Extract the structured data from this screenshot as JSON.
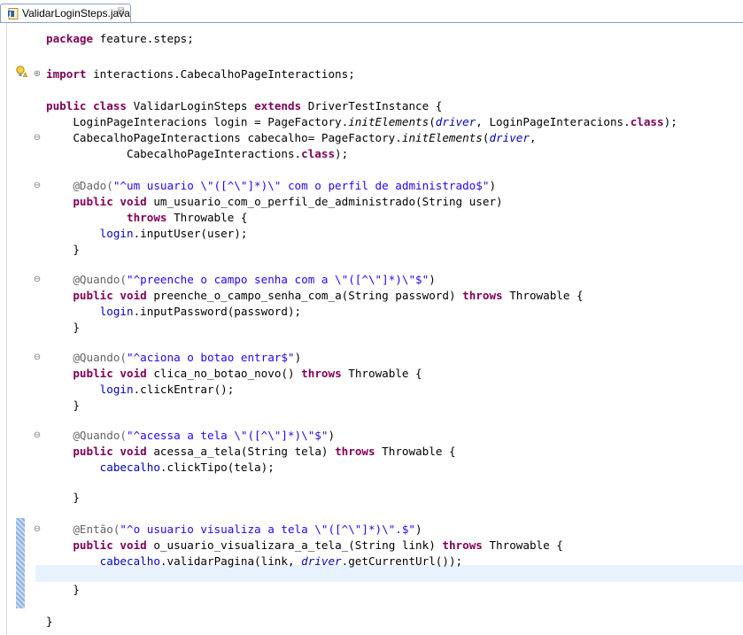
{
  "tab": {
    "title": "ValidarLoginSteps.java",
    "close_glyph": "☒",
    "icon": "java-file-icon"
  },
  "colors": {
    "keyword": "#7f0055",
    "string": "#2a00ff",
    "annotation": "#646464",
    "field": "#0000c0",
    "current_line": "#e8f2fe"
  },
  "code": {
    "l1": {
      "kw": "package",
      "rest": " feature.steps;"
    },
    "l2": {
      "kw": "import",
      "rest": " interactions.CabecalhoPageInteractions;"
    },
    "l3": {
      "kw1": "public",
      "kw2": "class",
      "rest1": " ValidarLoginSteps ",
      "kw3": "extends",
      "rest2": " DriverTestInstance {"
    },
    "l4": {
      "a": "    LoginPageInteracions login = PageFactory.",
      "b": "initElements",
      "c": "(",
      "d": "driver",
      "e": ", LoginPageInteracions.",
      "f": "class",
      "g": ");"
    },
    "l5": {
      "a": "    CabecalhoPageInteractions cabecalho= PageFactory.",
      "b": "initElements",
      "c": "(",
      "d": "driver",
      "e": ","
    },
    "l6": {
      "a": "            CabecalhoPageInteractions.",
      "b": "class",
      "c": ");"
    },
    "l7": {
      "ann": "    @Dado(",
      "str": "\"^um usuario \\\"([^\\\"]*)\\\" com o perfil de administrado$\"",
      "end": ")"
    },
    "l8": {
      "kw1": "    public",
      "kw2": "void",
      "rest": " um_usuario_com_o_perfil_de_administrado(String user)"
    },
    "l9": {
      "kw": "            throws",
      "rest": " Throwable {"
    },
    "l10": {
      "fld": "        login",
      "rest": ".inputUser(user);"
    },
    "l11": {
      "text": "    }"
    },
    "l12": {
      "ann": "    @Quando(",
      "str": "\"^preenche o campo senha com a \\\"([^\\\"]*)\\\"$\"",
      "end": ")"
    },
    "l13": {
      "kw1": "    public",
      "kw2": "void",
      "rest1": " preenche_o_campo_senha_com_a(String password) ",
      "kw3": "throws",
      "rest2": " Throwable {"
    },
    "l14": {
      "fld": "        login",
      "rest": ".inputPassword(password);"
    },
    "l15": {
      "text": "    }"
    },
    "l16": {
      "ann": "    @Quando(",
      "str": "\"^aciona o botao entrar$\"",
      "end": ")"
    },
    "l17": {
      "kw1": "    public",
      "kw2": "void",
      "rest1": " clica_no_botao_novo() ",
      "kw3": "throws",
      "rest2": " Throwable {"
    },
    "l18": {
      "fld": "        login",
      "rest": ".clickEntrar();"
    },
    "l19": {
      "text": "    }"
    },
    "l20": {
      "ann": "    @Quando(",
      "str": "\"^acessa a tela \\\"([^\\\"]*)\\\"$\"",
      "end": ")"
    },
    "l21": {
      "kw1": "    public",
      "kw2": "void",
      "rest1": " acessa_a_tela(String tela) ",
      "kw3": "throws",
      "rest2": " Throwable {"
    },
    "l22": {
      "fld": "        cabecalho",
      "rest": ".clickTipo(tela);"
    },
    "l23": {
      "text": "    }"
    },
    "l24": {
      "ann": "    @Então(",
      "str": "\"^o usuario visualiza a tela \\\"([^\\\"]*)\\\".$\"",
      "end": ")"
    },
    "l25": {
      "kw1": "    public",
      "kw2": "void",
      "rest1": " o_usuario_visualizara_a_tela_(String link) ",
      "kw3": "throws",
      "rest2": " Throwable {"
    },
    "l26": {
      "fld": "        cabecalho",
      "rest1": ".validarPagina(link, ",
      "it": "driver",
      "rest2": ".getCurrentUrl());"
    },
    "l27": {
      "text": "    }"
    },
    "l28": {
      "text": "}"
    }
  },
  "gutter": {
    "collapse": "⊖",
    "expand": "⊕"
  }
}
